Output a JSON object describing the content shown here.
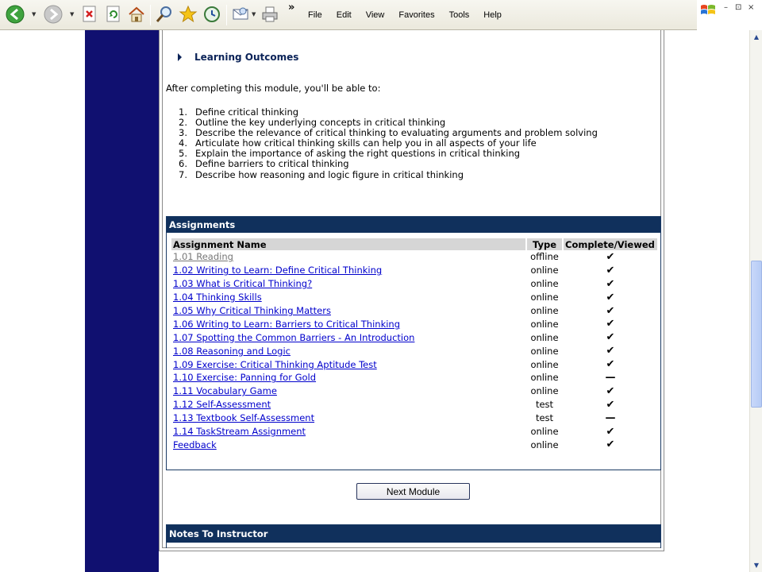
{
  "menubar": {
    "items": [
      "File",
      "Edit",
      "View",
      "Favorites",
      "Tools",
      "Help"
    ]
  },
  "toolbar": {
    "overflow_glyph": "»"
  },
  "window_controls": {
    "minimize": "–",
    "restore": "⊡",
    "close": "×"
  },
  "learning_outcomes": {
    "heading": "Learning Outcomes",
    "intro": "After completing this module, you'll be able to:",
    "items": [
      {
        "num": "1.",
        "text": "Define critical thinking"
      },
      {
        "num": "2.",
        "text": "Outline the key underlying concepts in critical thinking"
      },
      {
        "num": "3.",
        "text": "Describe the relevance of critical thinking to evaluating arguments and problem solving"
      },
      {
        "num": "4.",
        "text": "Articulate how critical thinking skills can help you in all aspects of your life"
      },
      {
        "num": "5.",
        "text": "Explain the importance of asking the right questions in critical thinking"
      },
      {
        "num": "6.",
        "text": "Define barriers to critical thinking"
      },
      {
        "num": "7.",
        "text": "Describe how reasoning and logic figure in critical thinking"
      }
    ]
  },
  "assignments": {
    "title": "Assignments",
    "headers": {
      "name": "Assignment Name",
      "type": "Type",
      "status": "Complete/Viewed"
    },
    "rows": [
      {
        "name": "1.01 Reading",
        "type": "offline",
        "status": "✔",
        "visited": true
      },
      {
        "name": "1.02 Writing to Learn: Define Critical Thinking",
        "type": "online",
        "status": "✔"
      },
      {
        "name": "1.03 What is Critical Thinking?",
        "type": "online",
        "status": "✔"
      },
      {
        "name": "1.04 Thinking Skills",
        "type": "online",
        "status": "✔"
      },
      {
        "name": "1.05 Why Critical Thinking Matters",
        "type": "online",
        "status": "✔"
      },
      {
        "name": "1.06 Writing to Learn: Barriers to Critical Thinking",
        "type": "online",
        "status": "✔"
      },
      {
        "name": "1.07 Spotting the Common Barriers - An Introduction",
        "type": "online",
        "status": "✔"
      },
      {
        "name": "1.08 Reasoning and Logic",
        "type": "online",
        "status": "✔"
      },
      {
        "name": "1.09 Exercise: Critical Thinking Aptitude Test",
        "type": "online",
        "status": "✔"
      },
      {
        "name": "1.10 Exercise: Panning for Gold",
        "type": "online",
        "status": "—"
      },
      {
        "name": "1.11 Vocabulary Game",
        "type": "online",
        "status": "✔"
      },
      {
        "name": "1.12 Self-Assessment",
        "type": "test",
        "status": "✔"
      },
      {
        "name": "1.13 Textbook Self-Assessment",
        "type": "test",
        "status": "—"
      },
      {
        "name": "1.14 TaskStream Assignment",
        "type": "online",
        "status": "✔"
      },
      {
        "name": "Feedback",
        "type": "online",
        "status": "✔"
      }
    ]
  },
  "next_button": {
    "label": "Next Module"
  },
  "notes": {
    "title": "Notes To Instructor"
  },
  "colors": {
    "nav_column": "#101070",
    "section_header": "#10305c",
    "link": "#0000cc",
    "visited_link": "#777777"
  }
}
